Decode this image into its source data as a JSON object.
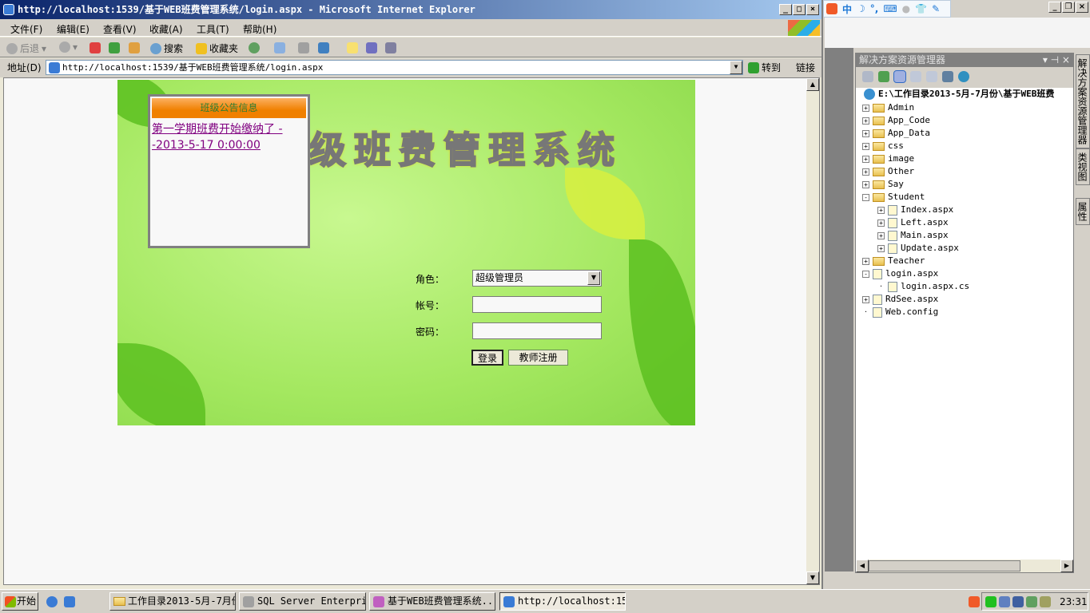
{
  "ie": {
    "title": "http://localhost:1539/基于WEB班费管理系统/login.aspx - Microsoft Internet Explorer",
    "menu": [
      "文件(F)",
      "编辑(E)",
      "查看(V)",
      "收藏(A)",
      "工具(T)",
      "帮助(H)"
    ],
    "toolbar": {
      "back": "后退",
      "search": "搜索",
      "favorites": "收藏夹"
    },
    "address_label": "地址(D)",
    "address": "http://localhost:1539/基于WEB班费管理系统/login.aspx",
    "go": "转到",
    "links": "链接"
  },
  "page": {
    "banner": "级班费管理系统",
    "notice": {
      "title": "班级公告信息",
      "item": "第一学期班费开始缴纳了 --2013-5-17 0:00:00"
    },
    "login": {
      "role_label": "角色：",
      "role_value": "超级管理员",
      "account_label": "帐号：",
      "account_value": "",
      "password_label": "密码：",
      "password_value": "",
      "login_button": "登录",
      "register_button": "教师注册"
    }
  },
  "ime": {
    "mode": "中"
  },
  "solution_explorer": {
    "title": "解决方案资源管理器",
    "root": "E:\\工作目录2013-5月-7月份\\基于WEB班费",
    "items": [
      {
        "label": "Admin",
        "type": "folder",
        "exp": "+"
      },
      {
        "label": "App_Code",
        "type": "folder",
        "exp": "+"
      },
      {
        "label": "App_Data",
        "type": "folder",
        "exp": "+"
      },
      {
        "label": "css",
        "type": "folder",
        "exp": "+"
      },
      {
        "label": "image",
        "type": "folder",
        "exp": "+"
      },
      {
        "label": "Other",
        "type": "folder",
        "exp": "+"
      },
      {
        "label": "Say",
        "type": "folder",
        "exp": "+"
      },
      {
        "label": "Student",
        "type": "folder",
        "exp": "-"
      },
      {
        "label": "Index.aspx",
        "type": "file",
        "exp": "+",
        "depth": 1
      },
      {
        "label": "Left.aspx",
        "type": "file",
        "exp": "+",
        "depth": 1
      },
      {
        "label": "Main.aspx",
        "type": "file",
        "exp": "+",
        "depth": 1
      },
      {
        "label": "Update.aspx",
        "type": "file",
        "exp": "+",
        "depth": 1
      },
      {
        "label": "Teacher",
        "type": "folder",
        "exp": "+"
      },
      {
        "label": "login.aspx",
        "type": "file",
        "exp": "-"
      },
      {
        "label": "login.aspx.cs",
        "type": "file",
        "exp": "",
        "depth": 1
      },
      {
        "label": "RdSee.aspx",
        "type": "file",
        "exp": "+"
      },
      {
        "label": "Web.config",
        "type": "file",
        "exp": ""
      }
    ],
    "side_tabs": [
      "解决方案资源管理器",
      "类视图",
      "属性"
    ]
  },
  "taskbar": {
    "start": "开始",
    "tasks": [
      "工作目录2013-5月-7月份",
      "SQL Server Enterpri...",
      "基于WEB班费管理系统...",
      "http://localhost:15..."
    ],
    "clock": "23:31"
  }
}
